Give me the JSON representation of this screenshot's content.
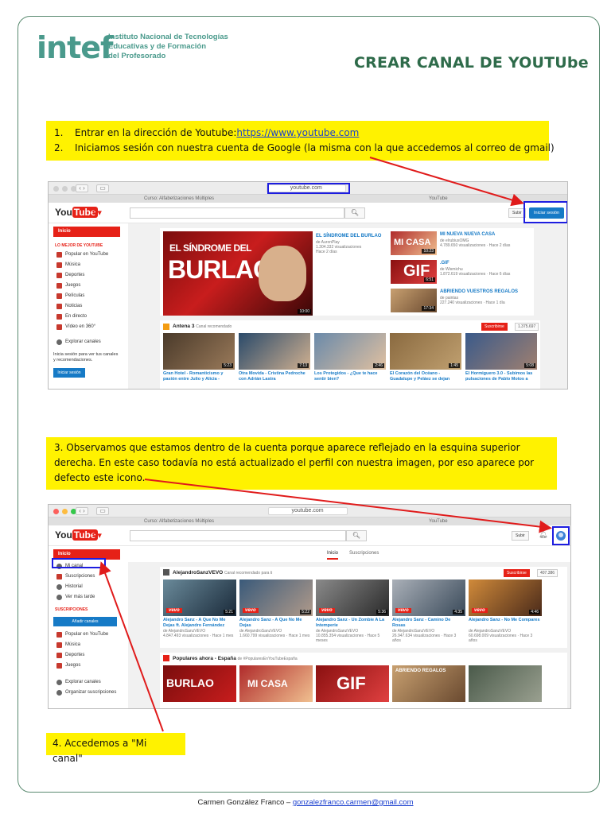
{
  "header": {
    "logo_mark": "intef",
    "logo_lines": [
      "Instituto Nacional de Tecnologías",
      "Educativas y de Formación",
      "del Profesorado"
    ],
    "title": "CREAR CANAL DE YOUTUbe"
  },
  "steps": {
    "step1_num": "1.",
    "step1_prefix": "Entrar en la dirección de Youtube: ",
    "step1_link": "https://www.youtube.com",
    "step2_num": "2.",
    "step2_text": "Iniciamos sesión con nuestra cuenta de Google (la misma con la que accedemos al correo de gmail)",
    "step3_line1": "3.   Observamos que estamos dentro de la cuenta porque aparece reflejado en la esquina superior",
    "step3_line2": "derecha. En este caso todavía no está actualizado el perfil con nuestra imagen, por eso aparece por",
    "step3_line3": "defecto este icono.",
    "step4": "4. Accedemos a \"Mi canal\""
  },
  "screen1": {
    "url": "youtube.com",
    "tab_left": "Curso: Alfabetizaciones Múltiples",
    "tab_right": "YouTube",
    "logo_you": "You",
    "logo_tube": "Tube",
    "logo_sup": "ES",
    "upload": "Subir",
    "signin": "Iniciar sesión",
    "sidebar": {
      "home": "Inicio",
      "section": "LO MEJOR DE YOUTUBE",
      "items": [
        "Popular en YouTube",
        "Música",
        "Deportes",
        "Juegos",
        "Películas",
        "Noticias",
        "En directo",
        "Vídeo en 360°"
      ],
      "explore": "Explorar canales",
      "note": "Inicia sesión para ver tus canales y recomendaciones.",
      "button": "Iniciar sesión"
    },
    "featured": {
      "img_top": "EL SÍNDROME DEL",
      "img_big": "BURLAO",
      "duration": "10:00",
      "title": "EL SÍNDROME DEL BURLAO",
      "channel": "de AuronPlay",
      "views": "1.304.332 visualizaciones",
      "age": "Hace 2 días"
    },
    "side_videos": [
      {
        "title": "MI NUEVA NUEVA CASA",
        "channel": "de elrubiusOMG",
        "meta": "4.789.650 visualizaciones · Hace 2 días",
        "thumb": "MI CASA",
        "dur": "10:23"
      },
      {
        "title": ".GIF",
        "channel": "de Wismichu",
        "meta": "1.872.619 visualizaciones · Hace 6 días",
        "thumb": "GIF",
        "dur": "6:51"
      },
      {
        "title": "ABRIENDO VUESTROS REGALOS",
        "channel": "de paintas",
        "meta": "227.240 visualizaciones · Hace 1 día",
        "thumb": "",
        "dur": "17:34"
      }
    ],
    "channel_row": {
      "name": "Antena 3",
      "tag": "Canal recomendado",
      "subscribe": "Suscribirse",
      "count": "1.375.697"
    },
    "row_videos": [
      {
        "title": "Gran Hotel - Romanticismo y pasión entre Julio y Alicia -",
        "dur": "5:23"
      },
      {
        "title": "Otra Movida - Cristina Pedroche con Adrián Lastra",
        "dur": "7:13"
      },
      {
        "title": "Los Protegidos - ¿Que te hace sentir bien?",
        "dur": "2:46"
      },
      {
        "title": "El Corazón del Océano - Guadalupe y Peláez se dejan",
        "dur": "1:45"
      },
      {
        "title": "El Hormiguero 3.0 - Subimos las pulsaciones de Pablo Motos a",
        "dur": "5:08"
      }
    ]
  },
  "screen2": {
    "url": "youtube.com",
    "tab_left": "Curso: Alfabetizaciones Múltiples",
    "tab_right": "YouTube",
    "upload": "Subir",
    "tabs": [
      "Inicio",
      "Suscripciones"
    ],
    "sidebar": {
      "items_top": [
        "Inicio",
        "Mi canal",
        "Suscripciones",
        "Historial",
        "Ver más tarde"
      ],
      "section": "SUSCRIPCIONES",
      "add_button": "Añadir canales",
      "subs": [
        "Popular en YouTube",
        "Música",
        "Deportes",
        "Juegos"
      ],
      "bottom": [
        "Explorar canales",
        "Organizar suscripciones"
      ]
    },
    "channel_row": {
      "name": "AlejandroSanzVEVO",
      "tag": "Canal recomendado para ti",
      "subscribe": "Suscribirse",
      "count": "407.386"
    },
    "vevo_videos": [
      {
        "title": "Alejandro Sanz - A Que No Me Dejas ft. Alejandro Fernández",
        "channel": "de AlejandroSanzVEVO",
        "meta": "4.847.493 visualizaciones · Hace 1 mes",
        "dur": "5:21"
      },
      {
        "title": "Alejandro Sanz - A Que No Me Dejas",
        "channel": "de AlejandroSanzVEVO",
        "meta": "1.660.799 visualizaciones · Hace 1 mes",
        "dur": "5:22"
      },
      {
        "title": "Alejandro Sanz - Un Zombie A La Intemperie",
        "channel": "de AlejandroSanzVEVO",
        "meta": "10.855.354 visualizaciones · Hace 5 meses",
        "dur": "5:36"
      },
      {
        "title": "Alejandro Sanz - Camino De Rosas",
        "channel": "de AlejandroSanzVEVO",
        "meta": "26.947.634 visualizaciones · Hace 3 años",
        "dur": "4:35"
      },
      {
        "title": "Alejandro Sanz - No Me Compares",
        "channel": "de AlejandroSanzVEVO",
        "meta": "60.698.009 visualizaciones · Hace 3 años",
        "dur": "4:46"
      }
    ],
    "vevo_label": "vevo",
    "popular_row": {
      "name": "Populares ahora - España",
      "tag": "de #PopularesEnYouTubeEspaña"
    },
    "popular_thumbs": [
      "BURLAO",
      "MI CASA",
      "GIF",
      "ABRIENDO REGALOS",
      ""
    ]
  },
  "footer": {
    "author": "Carmen González Franco – ",
    "email": "gonzalezfranco.carmen@gmail.com"
  },
  "colors": {
    "highlight": "#fff200",
    "title_green": "#2e6b4a",
    "youtube_red": "#e62117",
    "youtube_blue": "#167ac6",
    "annotation_red": "#e01b1b",
    "annotation_box": "#1d1de0"
  }
}
